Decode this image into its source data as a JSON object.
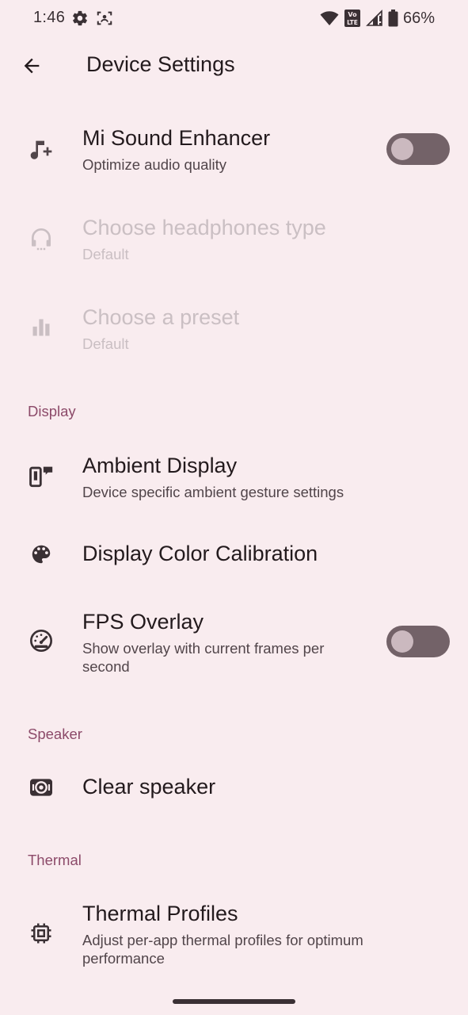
{
  "status_bar": {
    "time": "1:46",
    "battery_percent": "66%",
    "icons": [
      "gear-icon",
      "face-scan-icon",
      "wifi-icon",
      "volte-icon",
      "signal-icon",
      "battery-icon"
    ],
    "lte_badge_top": "Vo",
    "lte_badge_bottom": "LTE"
  },
  "app_bar": {
    "title": "Device Settings",
    "back_icon": "arrow-back-icon"
  },
  "sections": {
    "display_header": "Display",
    "speaker_header": "Speaker",
    "thermal_header": "Thermal"
  },
  "prefs": {
    "sound_enhancer": {
      "title": "Mi Sound Enhancer",
      "summary": "Optimize audio quality",
      "icon": "music-note-add-icon",
      "enabled": false
    },
    "headphones": {
      "title": "Choose headphones type",
      "summary": "Default",
      "icon": "headphones-icon",
      "disabled": true
    },
    "preset": {
      "title": "Choose a preset",
      "summary": "Default",
      "icon": "equalizer-icon",
      "disabled": true
    },
    "ambient_display": {
      "title": "Ambient Display",
      "summary": "Device specific ambient gesture settings",
      "icon": "ambient-display-icon"
    },
    "color_calibration": {
      "title": "Display Color Calibration",
      "icon": "palette-icon"
    },
    "fps_overlay": {
      "title": "FPS Overlay",
      "summary": "Show overlay with current frames per second",
      "icon": "speedometer-icon",
      "enabled": false
    },
    "clear_speaker": {
      "title": "Clear speaker",
      "icon": "speaker-icon"
    },
    "thermal_profiles": {
      "title": "Thermal Profiles",
      "summary": "Adjust per-app thermal profiles for optimum performance",
      "icon": "chip-icon"
    }
  },
  "colors": {
    "background": "#f9ecef",
    "accent": "#8c4a69",
    "switch_track_off": "#736268",
    "switch_thumb_off": "#cbb9bf",
    "text_primary": "#231a1d",
    "text_secondary": "#51454a",
    "text_disabled": "#cabfc3"
  }
}
